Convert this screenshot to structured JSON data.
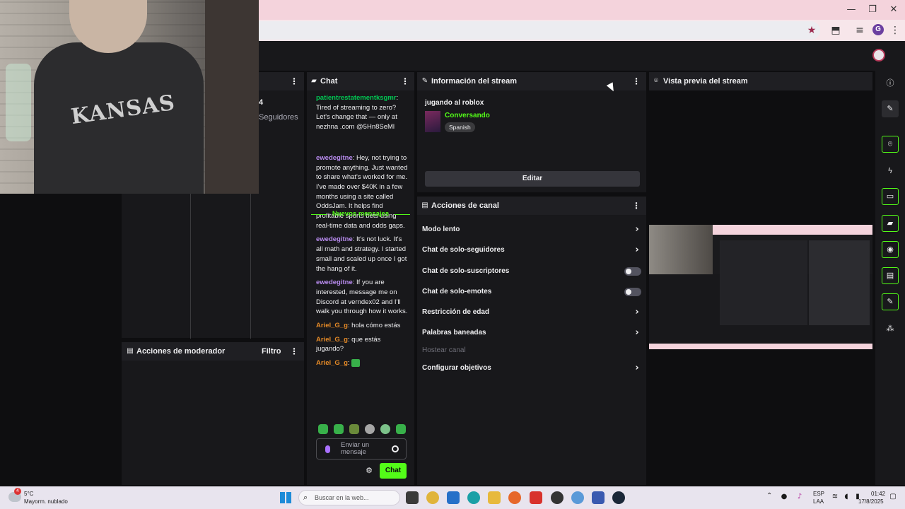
{
  "browser": {
    "window_controls": {
      "minimize": "—",
      "restore": "❐",
      "close": "✕"
    },
    "toolbar_icons": [
      "star-icon",
      "extensions-icon",
      "media-icon",
      "profile-avatar",
      "menu-icon"
    ],
    "profile_letter": "G",
    "accent": "#f4d3dc"
  },
  "left_panel": {
    "follower_count": "4",
    "follower_label": "Seguidores"
  },
  "mod_panel": {
    "title": "Acciones de moderador",
    "filter_label": "Filtro"
  },
  "chat": {
    "title": "Chat",
    "messages_before": [
      {
        "user": "patientrestatementksgmr",
        "color": "green",
        "text": "Tired of streaming to zero? Let's change that — only at nezhna .com @5Hn8SeMl"
      }
    ],
    "new_messages_label": "Nuevos mensajes",
    "messages_after": [
      {
        "user": "ewedegitne",
        "color": "purple",
        "text": "Hey, not trying to promote anything. Just wanted to share what's worked for me. I've made over $40K in a few months using a site called OddsJam. It helps find profitable sports bets using real-time data and odds gaps."
      },
      {
        "user": "ewedegitne",
        "color": "purple",
        "text": "It's not luck. It's all math and strategy. I started small and scaled up once I got the hang of it."
      },
      {
        "user": "ewedegitne",
        "color": "purple",
        "text": "If you are interested, message me on Discord at verndex02 and I'll walk you through how it works."
      },
      {
        "user": "Ariel_G_g",
        "color": "orange",
        "text": "hola cómo estás"
      },
      {
        "user": "Ariel_G_g",
        "color": "orange",
        "text": "que estás jugando?"
      },
      {
        "user": "Ariel_G_g",
        "color": "orange",
        "text": ""
      }
    ],
    "input_placeholder": "Enviar un mensaje",
    "send_label": "Chat",
    "emote_count": 6
  },
  "stream_info": {
    "title": "Información del stream",
    "stream_title": "jugando al roblox",
    "category": "Conversando",
    "language_tag": "Spanish",
    "edit_label": "Editar"
  },
  "channel_actions": {
    "title": "Acciones de canal",
    "items": [
      {
        "label": "Modo lento",
        "control": "chevron"
      },
      {
        "label": "Chat de solo-seguidores",
        "control": "chevron"
      },
      {
        "label": "Chat de solo-suscriptores",
        "control": "toggle",
        "on": false
      },
      {
        "label": "Chat de solo-emotes",
        "control": "toggle",
        "on": false
      },
      {
        "label": "Restricción de edad",
        "control": "chevron"
      },
      {
        "label": "Palabras baneadas",
        "control": "chevron"
      },
      {
        "label": "Hostear canal",
        "control": "none",
        "disabled": true
      },
      {
        "label": "Configurar objetivos",
        "control": "chevron"
      }
    ]
  },
  "preview": {
    "title": "Vista previa del stream"
  },
  "right_rail": {
    "icons": [
      "info-icon",
      "pencil-icon",
      "focus-icon",
      "lightning-icon",
      "notes-icon",
      "chat-bubble-icon",
      "broadcast-icon",
      "layout-icon",
      "wrench-icon",
      "community-icon"
    ]
  },
  "taskbar": {
    "weather_badge": "4",
    "weather_temp": "5°C",
    "weather_desc": "Mayorm. nublado",
    "search_placeholder": "Buscar en la web...",
    "language_top": "ESP",
    "language_bottom": "LAA",
    "time": "01:42",
    "date": "17/8/2025"
  },
  "colors": {
    "accent_green": "#53fc18",
    "panel_bg": "#18181b",
    "username_green": "#00c853",
    "username_purple": "#b98cf0",
    "username_orange": "#e58a27"
  }
}
